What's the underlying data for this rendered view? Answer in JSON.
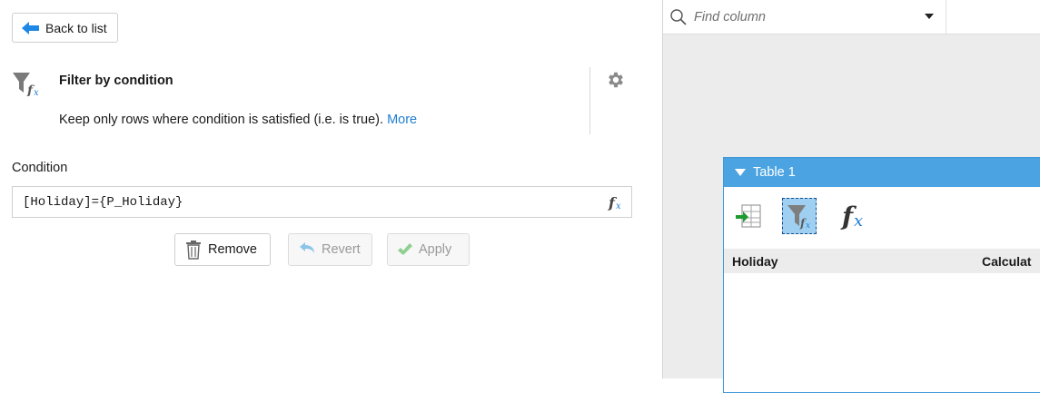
{
  "left": {
    "back_label": "Back to list",
    "step": {
      "title": "Filter by condition",
      "description": "Keep only rows where condition is satisfied (i.e. is true).",
      "more_link": "More"
    },
    "condition": {
      "label": "Condition",
      "value": "[Holiday]={P_Holiday}"
    },
    "actions": {
      "remove_label": "Remove",
      "revert_label": "Revert",
      "apply_label": "Apply"
    }
  },
  "right": {
    "find_column": {
      "placeholder": "Find column"
    },
    "table": {
      "title": "Table 1",
      "columns": [
        "Holiday",
        "Calculat"
      ]
    }
  },
  "colors": {
    "accent_blue": "#1f7fd1",
    "table_header": "#4ba4e1",
    "selected_tool": "#9fd0f2",
    "apply_check": "#5cb85c",
    "revert_arrow": "#4aa3df",
    "back_arrow": "#1e88e5"
  }
}
